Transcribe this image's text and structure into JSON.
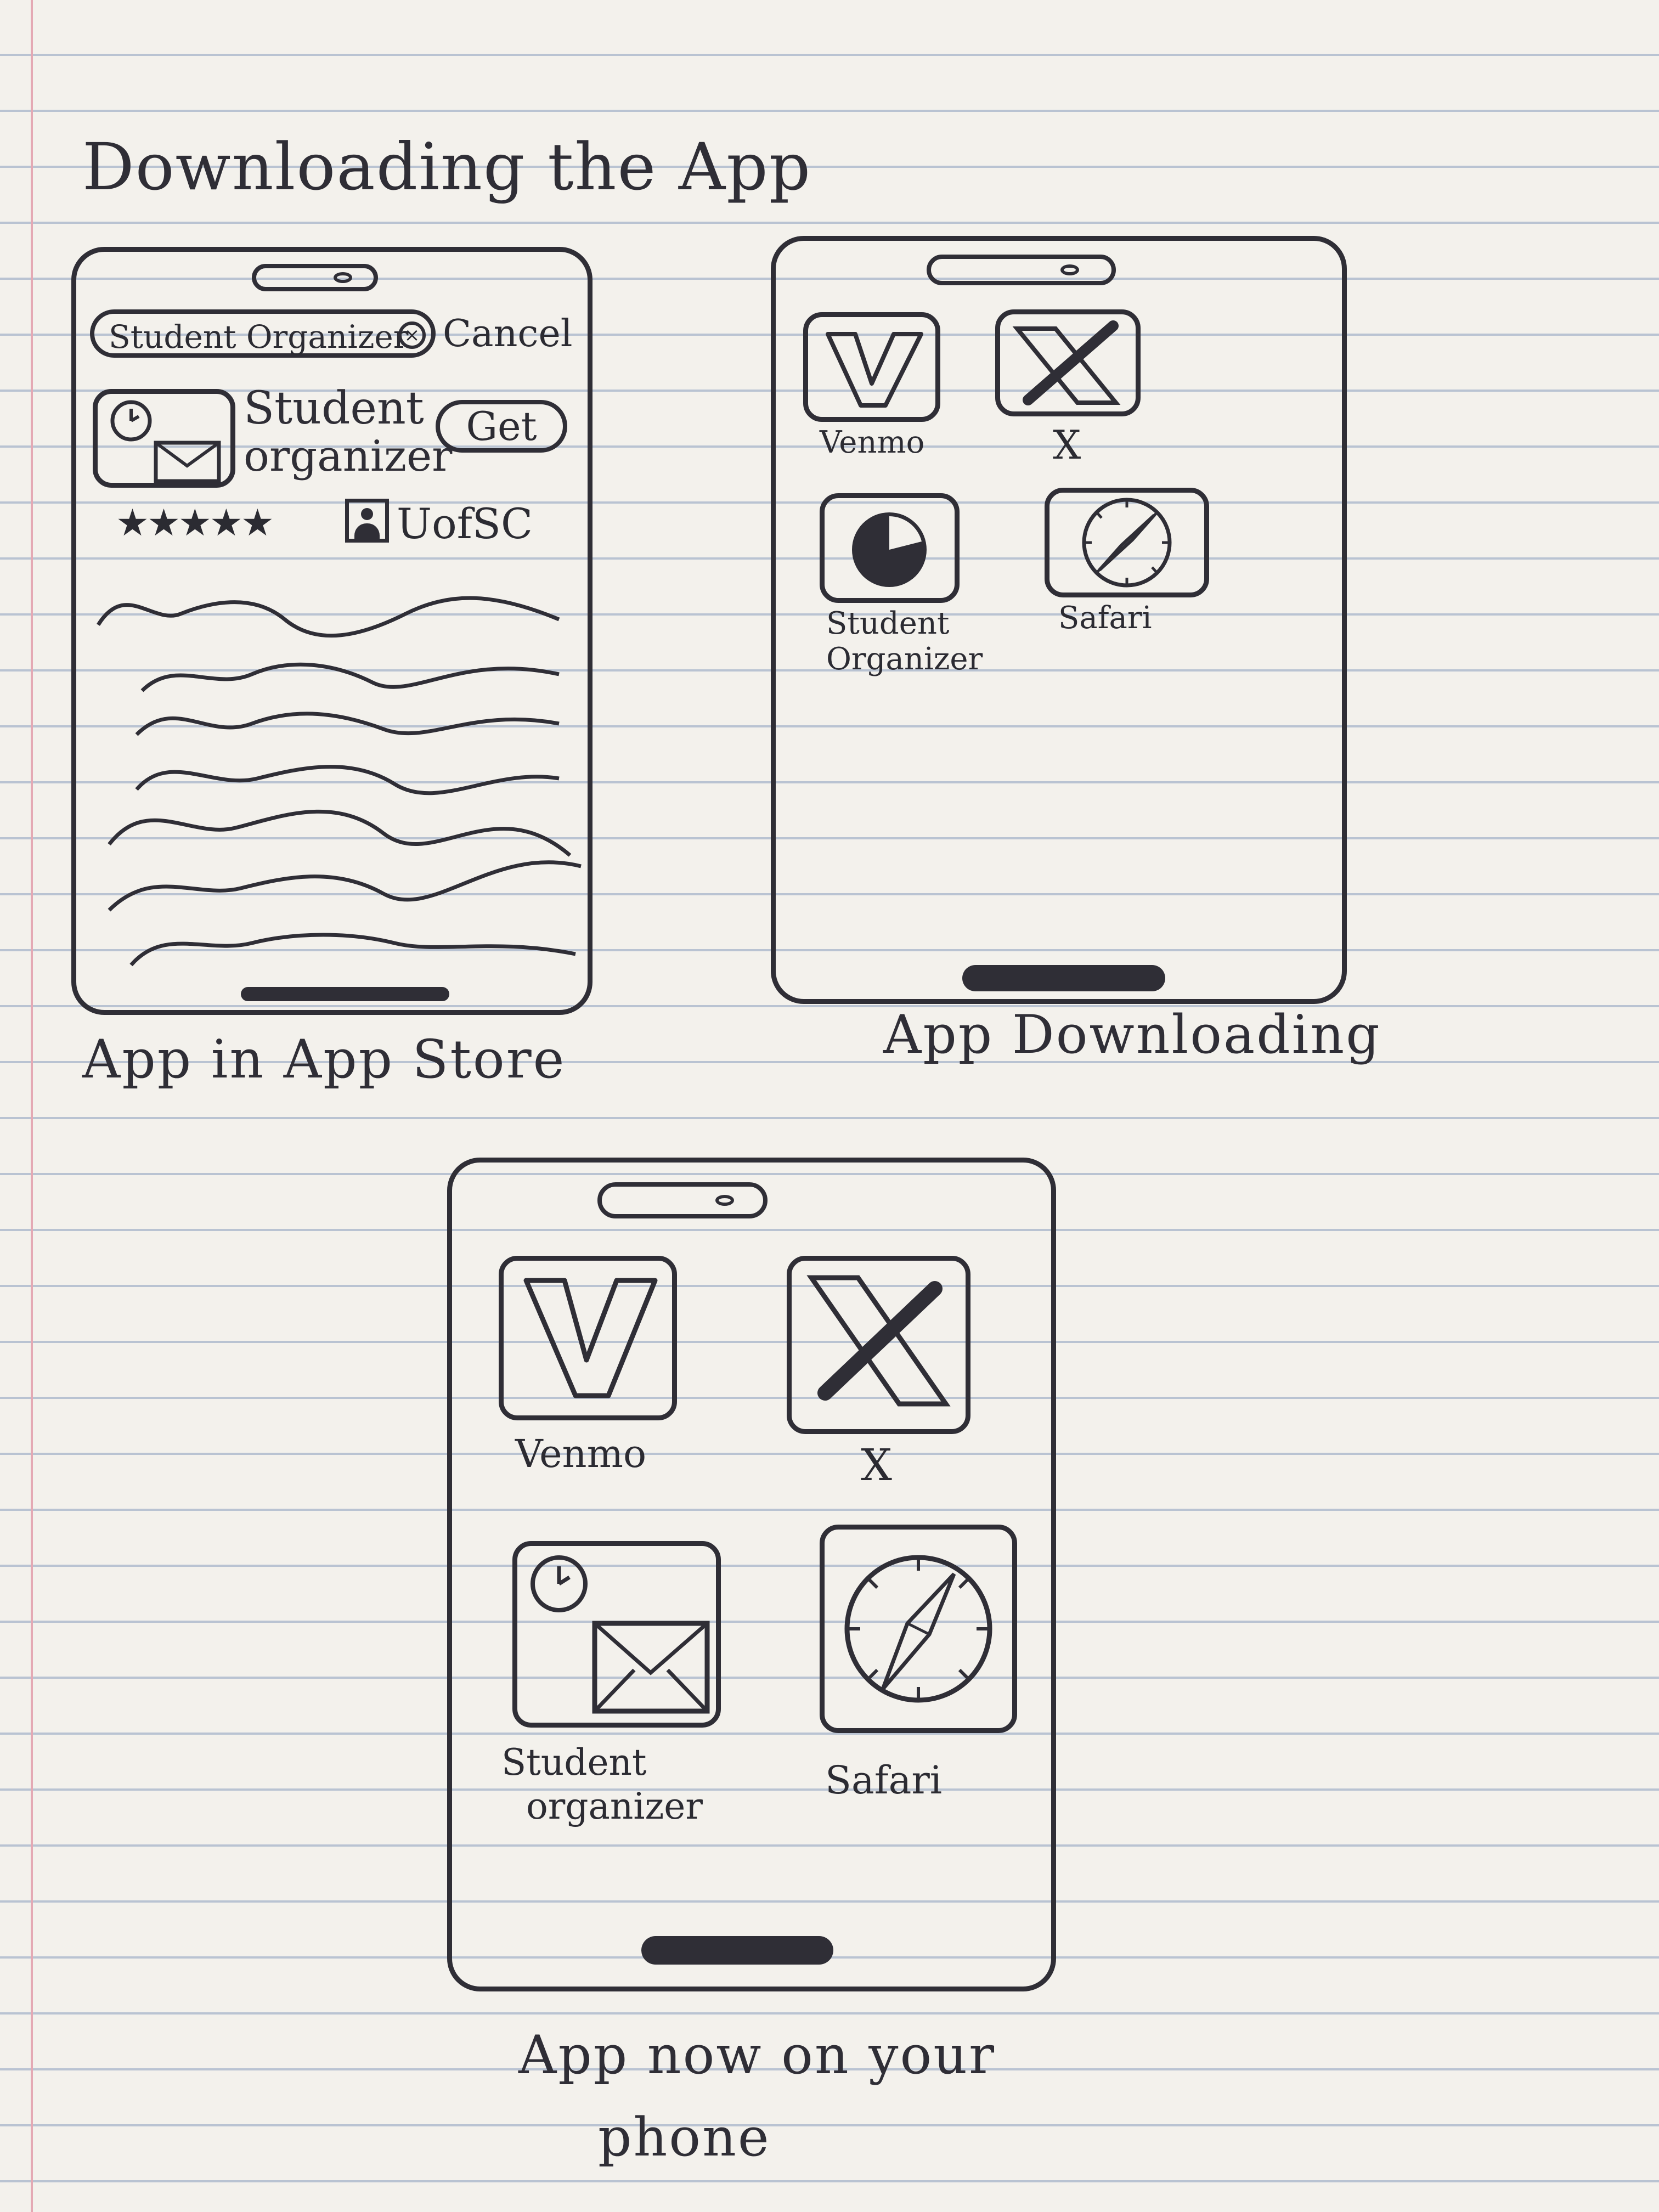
{
  "page_title": "Downloading the App",
  "screens": [
    {
      "caption": "App in App Store",
      "search": {
        "value": "Student Organizer",
        "cancel_label": "Cancel"
      },
      "result": {
        "app_name_line1": "Student",
        "app_name_line2": "organizer",
        "get_label": "Get",
        "rating": "★★★★★",
        "developer": "UofSC"
      }
    },
    {
      "caption": "App Downloading",
      "apps": [
        {
          "label": "Venmo",
          "icon": "venmo-icon"
        },
        {
          "label": "X",
          "icon": "x-icon"
        },
        {
          "label_line1": "Student",
          "label_line2": "Organizer",
          "icon": "download-progress-icon"
        },
        {
          "label": "Safari",
          "icon": "compass-icon"
        }
      ]
    },
    {
      "caption_line1": "App now on your",
      "caption_line2": "phone",
      "apps": [
        {
          "label": "Venmo",
          "icon": "venmo-icon"
        },
        {
          "label": "X",
          "icon": "x-icon"
        },
        {
          "label_line1": "Student",
          "label_line2": "organizer",
          "icon": "clock-envelope-icon"
        },
        {
          "label": "Safari",
          "icon": "compass-icon"
        }
      ]
    }
  ],
  "colors": {
    "ink": "#2f2e36",
    "paper": "#f3f1ec",
    "rule_line": "#b9c3d2",
    "margin_line": "#e4a9b4"
  }
}
